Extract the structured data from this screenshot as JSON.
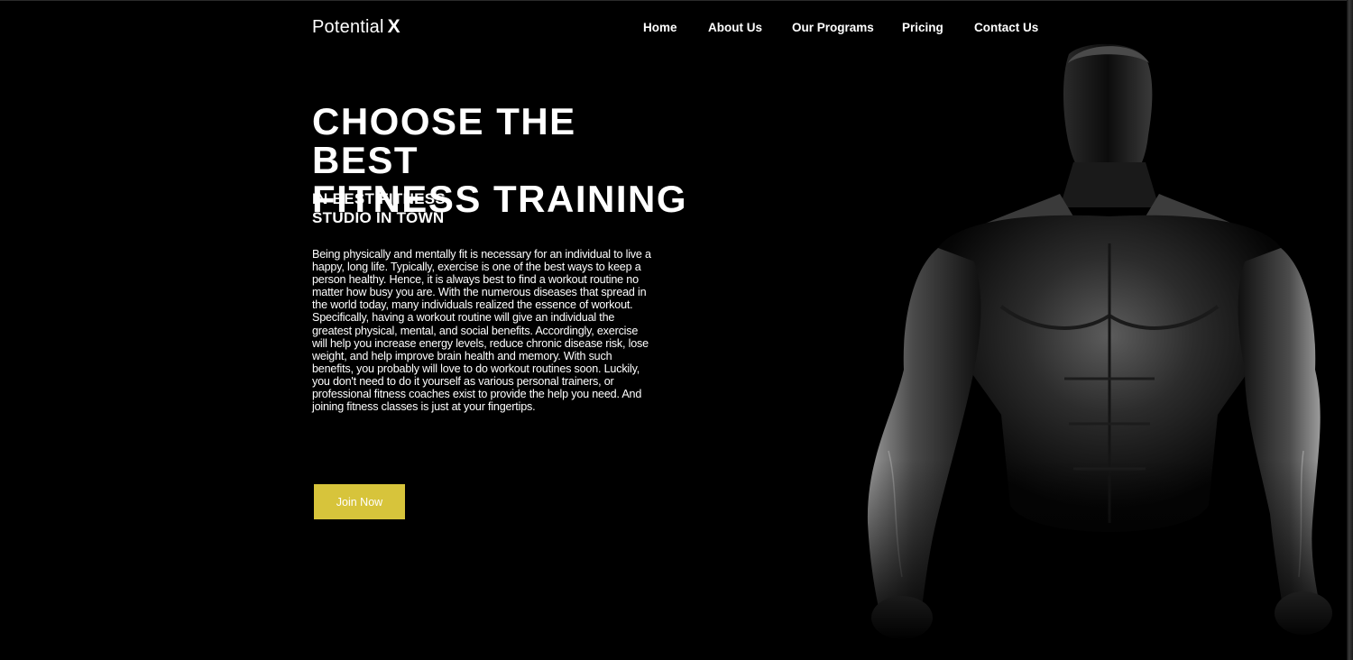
{
  "brand": {
    "name": "Potential",
    "mark": "X"
  },
  "nav": {
    "items": [
      "Home",
      "About Us",
      "Our Programs",
      "Pricing",
      "Contact Us"
    ]
  },
  "hero": {
    "title_line1": "CHOOSE THE BEST",
    "title_line2": "FITNESS TRAINING",
    "subtitle_line1": "IN BEST FITNESS",
    "subtitle_line2": "STUDIO IN TOWN",
    "body": "Being physically and mentally fit is necessary for an individual to live a happy, long life. Typically, exercise is one of the best ways to keep a person healthy. Hence, it is always best to find a workout routine no matter how busy you are. With the numerous diseases that spread in the world today, many individuals realized the essence of workout. Specifically, having a workout routine will give an individual the greatest physical, mental, and social benefits. Accordingly, exercise will help you increase energy levels, reduce chronic disease risk, lose weight, and help improve brain health and memory. With such benefits, you probably will love to do workout routines soon. Luckily, you don't need to do it yourself as various personal trainers, or professional fitness coaches exist to provide the help you need. And joining fitness classes is just at your fingertips.",
    "cta_label": "Join Now",
    "image_subject": "muscular-man-silhouette"
  },
  "colors": {
    "background": "#000000",
    "text": "#ffffff",
    "accent": "#d7c43b"
  }
}
